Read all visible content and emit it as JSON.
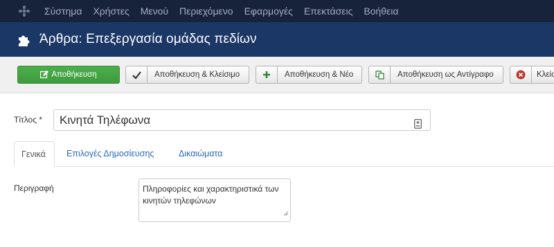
{
  "menubar": {
    "items": [
      "Σύστημα",
      "Χρήστες",
      "Μενού",
      "Περιεχόμενο",
      "Εφαρμογές",
      "Επεκτάσεις",
      "Βοήθεια"
    ]
  },
  "titlebar": {
    "title": "Άρθρα: Επεξεργασία ομάδας πεδίων"
  },
  "toolbar": {
    "save_label": "Αποθήκευση",
    "save_close_label": "Αποθήκευση & Κλείσιμο",
    "save_new_label": "Αποθήκευση & Νέο",
    "save_copy_label": "Αποθήκευση ως Αντίγραφο",
    "close_label": "Κλείσιμο"
  },
  "form": {
    "title_label": "Τίτλος *",
    "title_value": "Κινητά Τηλέφωνα",
    "tabs": [
      "Γενικά",
      "Επιλογές Δημοσίευσης",
      "Δικαιώματα"
    ],
    "active_tab": "Γενικά",
    "description_label": "Περιγραφή",
    "description_value": "Πληροφορίες και χαρακτηριστικά των κινητών τηλεφώνων"
  },
  "colors": {
    "menubar_bg": "#17223b",
    "titlebar_bg": "#1b3766",
    "save_green": "#46a546",
    "link_blue": "#2a69b8",
    "close_red": "#bd362f"
  }
}
